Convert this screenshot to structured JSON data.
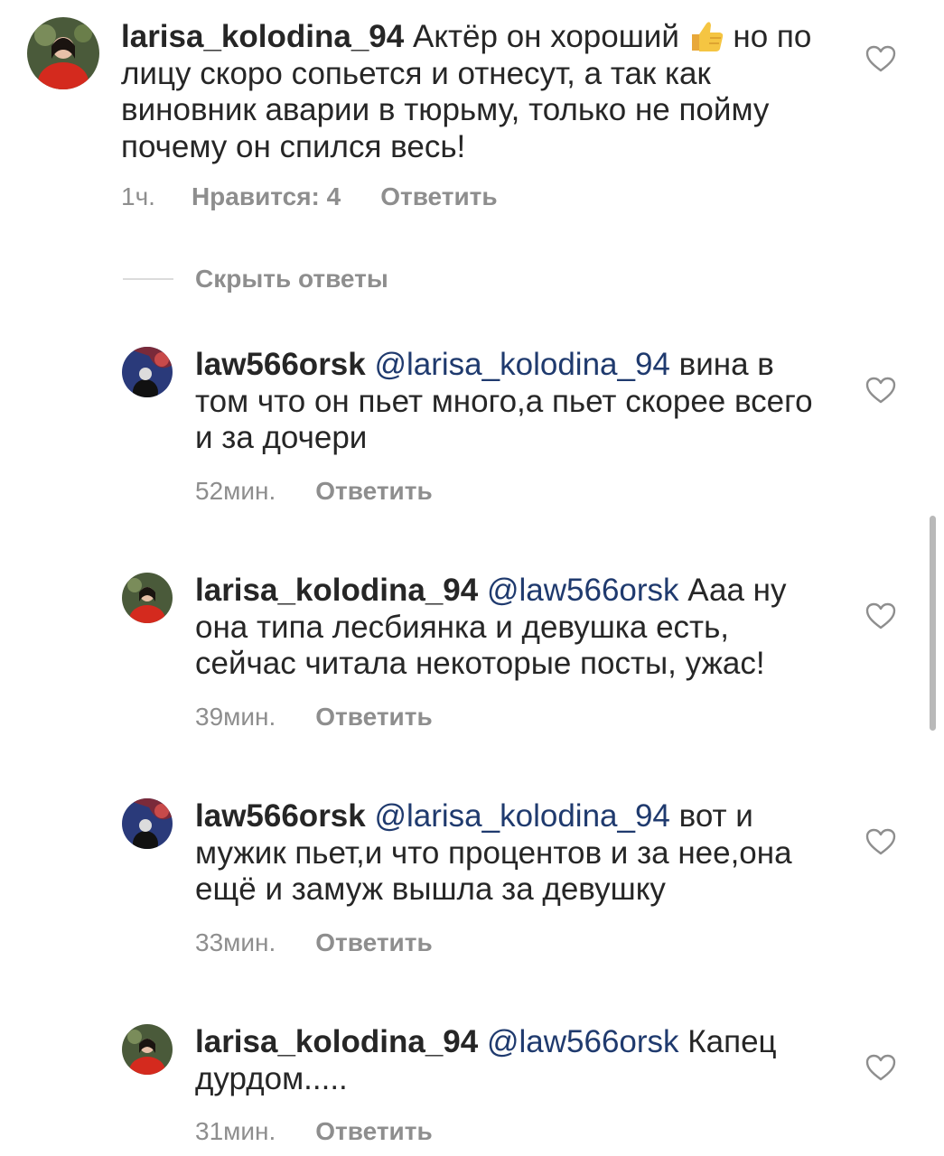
{
  "comments": [
    {
      "username": "larisa_kolodina_94",
      "text_before_emoji": "Актёр он хороший ",
      "emoji": "thumbs-up-emoji",
      "text_after_emoji": " но по лицу скоро сопьется и отнесут, а так как виновник аварии в тюрьму, только не пойму почему он спился весь!",
      "time": "1ч.",
      "likes": "Нравится: 4",
      "reply": "Ответить"
    },
    {
      "username": "law566orsk",
      "mention": "@larisa_kolodina_94",
      "text": " вина в том что он пьет много,а пьет скорее всего и за дочери",
      "time": "52мин.",
      "reply": "Ответить"
    },
    {
      "username": "larisa_kolodina_94",
      "mention": "@law566orsk",
      "text": " Ааа ну она типа лесбиянка и девушка есть, сейчас читала некоторые посты, ужас!",
      "time": "39мин.",
      "reply": "Ответить"
    },
    {
      "username": "law566orsk",
      "mention": "@larisa_kolodina_94",
      "text": " вот и мужик пьет,и что процентов и за нее,она ещё и замуж вышла за девушку",
      "time": "33мин.",
      "reply": "Ответить"
    },
    {
      "username": "larisa_kolodina_94",
      "mention": "@law566orsk",
      "text": " Капец дурдом.....",
      "time": "31мин.",
      "reply": "Ответить"
    }
  ],
  "hide_replies_label": "Скрыть ответы",
  "icons": {
    "like": "heart-outline-icon",
    "avatar_larisa": "avatar-red-dress",
    "avatar_law": "avatar-dark-figure"
  },
  "colors": {
    "text": "#262626",
    "meta": "#8e8e8e",
    "mention": "#1f3a6e"
  }
}
